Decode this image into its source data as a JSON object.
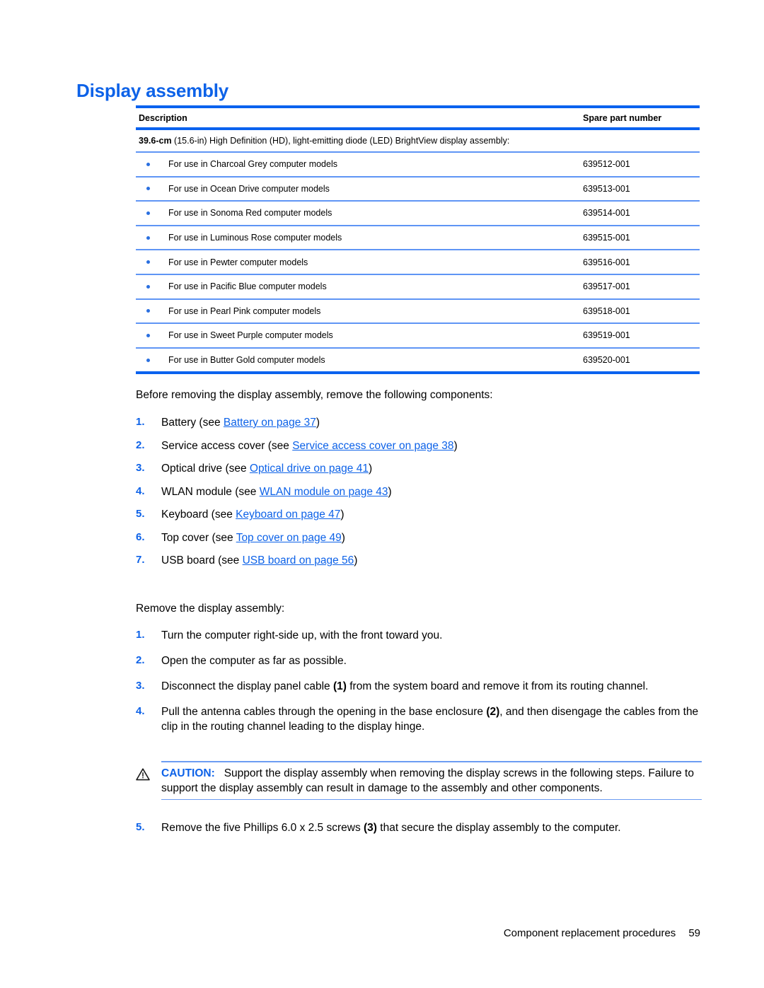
{
  "document": {
    "heading": "Display assembly"
  },
  "colors": {
    "accent_blue": "#0d62e8",
    "rule_thick": "#0a62ef",
    "rule_thin": "#5f95f5",
    "bullet": "#2a6fe0"
  },
  "table": {
    "columns": {
      "description": "Description",
      "spare_part_number": "Spare part number"
    },
    "group_label_bold": "39.6-cm",
    "group_label_rest": " (15.6-in) High Definition (HD), light-emitting diode (LED) BrightView display assembly:",
    "rows": [
      {
        "description": "For use in Charcoal Grey computer models",
        "part": "639512-001"
      },
      {
        "description": "For use in Ocean Drive computer models",
        "part": "639513-001"
      },
      {
        "description": "For use in Sonoma Red computer models",
        "part": "639514-001"
      },
      {
        "description": "For use in Luminous Rose computer models",
        "part": "639515-001"
      },
      {
        "description": "For use in Pewter computer models",
        "part": "639516-001"
      },
      {
        "description": "For use in Pacific Blue computer models",
        "part": "639517-001"
      },
      {
        "description": "For use in Pearl Pink computer models",
        "part": "639518-001"
      },
      {
        "description": "For use in Sweet Purple computer models",
        "part": "639519-001"
      },
      {
        "description": "For use in Butter Gold computer models",
        "part": "639520-001"
      }
    ]
  },
  "prereq": {
    "intro": "Before removing the display assembly, remove the following components:",
    "items": [
      {
        "num": "1.",
        "pre": "Battery (see ",
        "link": "Battery on page 37",
        "post": ")"
      },
      {
        "num": "2.",
        "pre": "Service access cover (see ",
        "link": "Service access cover on page 38",
        "post": ")"
      },
      {
        "num": "3.",
        "pre": "Optical drive (see ",
        "link": "Optical drive on page 41",
        "post": ")"
      },
      {
        "num": "4.",
        "pre": "WLAN module (see ",
        "link": "WLAN module on page 43",
        "post": ")"
      },
      {
        "num": "5.",
        "pre": "Keyboard (see ",
        "link": "Keyboard on page 47",
        "post": ")"
      },
      {
        "num": "6.",
        "pre": "Top cover (see ",
        "link": "Top cover on page 49",
        "post": ")"
      },
      {
        "num": "7.",
        "pre": "USB board (see ",
        "link": "USB board on page 56",
        "post": ")"
      }
    ]
  },
  "procedure": {
    "intro": "Remove the display assembly:",
    "steps": [
      {
        "num": "1.",
        "text": "Turn the computer right-side up, with the front toward you."
      },
      {
        "num": "2.",
        "text": "Open the computer as far as possible."
      },
      {
        "num": "3.",
        "pre": "Disconnect the display panel cable ",
        "mark": "(1)",
        "post": " from the system board and remove it from its routing channel."
      },
      {
        "num": "4.",
        "pre": "Pull the antenna cables through the opening in the base enclosure ",
        "mark": "(2)",
        "post": ", and then disengage the cables from the clip in the routing channel leading to the display hinge."
      }
    ],
    "final_step": {
      "num": "5.",
      "pre": "Remove the five Phillips 6.0 x 2.5 screws ",
      "mark": "(3)",
      "post": " that secure the display assembly to the computer."
    }
  },
  "caution": {
    "label": "CAUTION:",
    "text": "Support the display assembly when removing the display screws in the following steps. Failure to support the display assembly can result in damage to the assembly and other components."
  },
  "footer": {
    "title": "Component replacement procedures",
    "page_number": "59"
  }
}
